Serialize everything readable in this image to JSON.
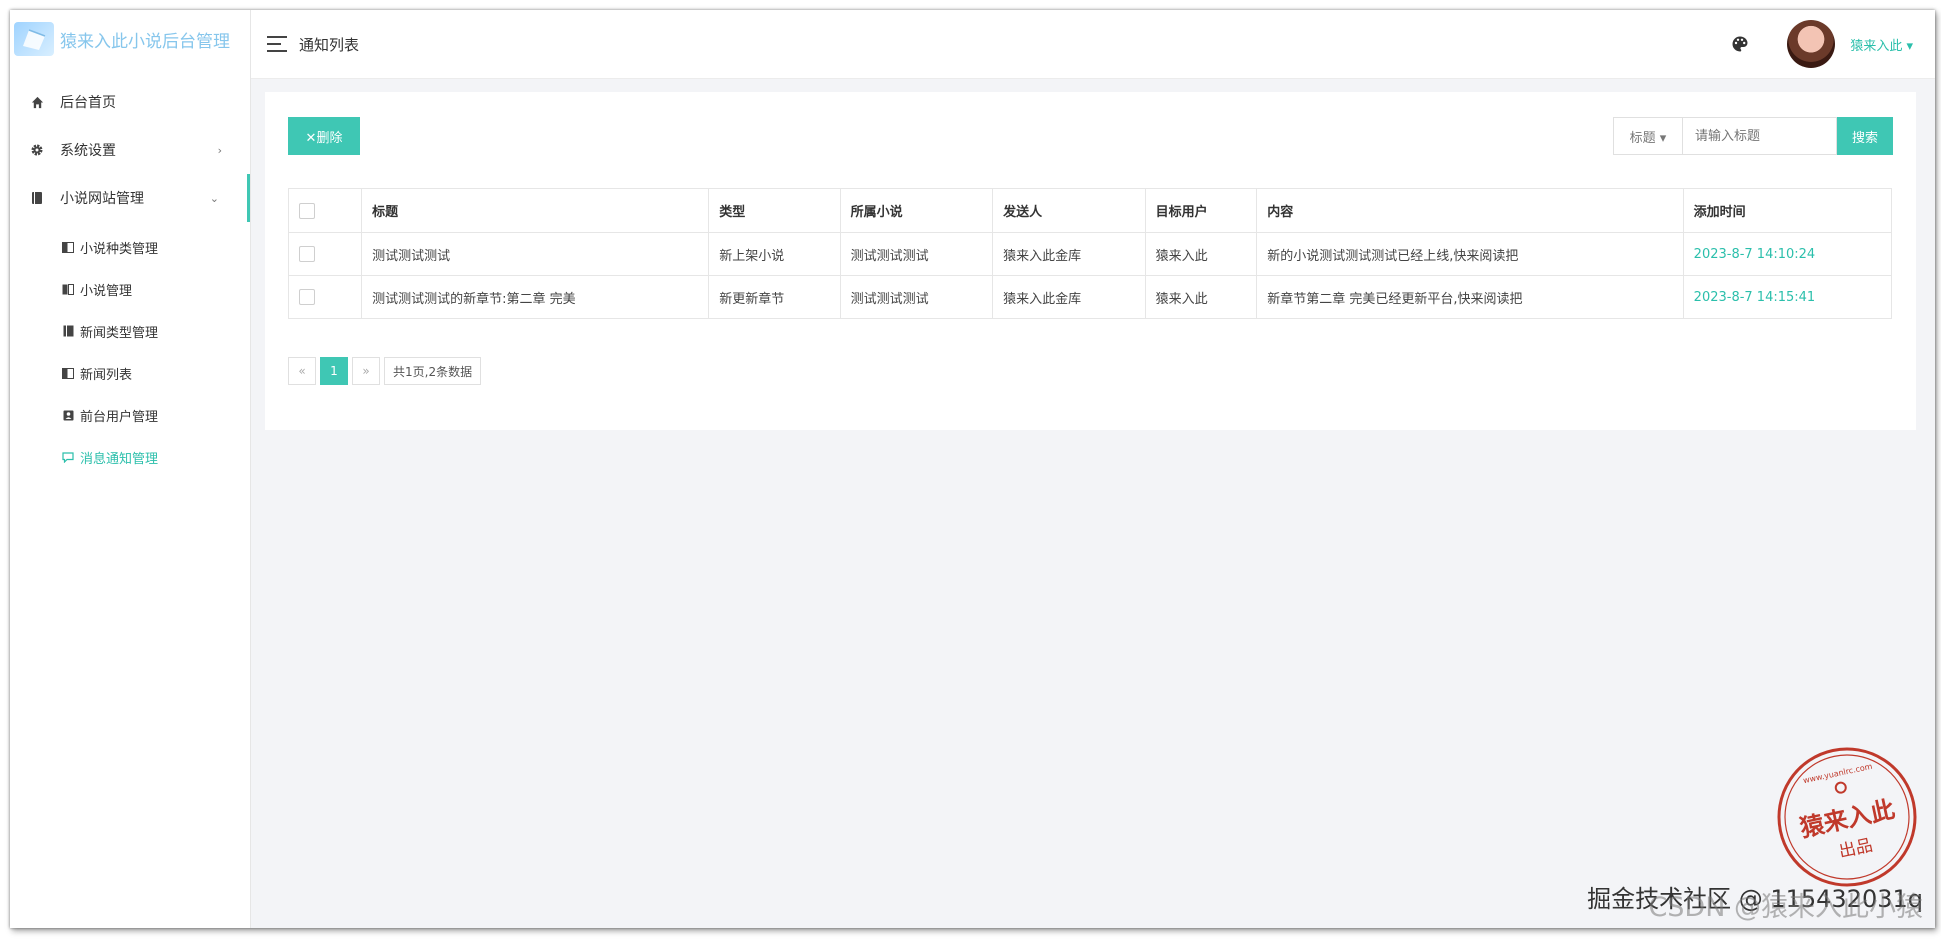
{
  "app": {
    "title": "猿来入此小说后台管理"
  },
  "sidebar": {
    "items": [
      {
        "label": "后台首页",
        "icon": "home-icon"
      },
      {
        "label": "系统设置",
        "icon": "gear-icon",
        "arrow": "›"
      },
      {
        "label": "小说网站管理",
        "icon": "book-icon",
        "arrow": "⌄"
      }
    ],
    "subitems": [
      {
        "label": "小说种类管理",
        "icon": "category-icon"
      },
      {
        "label": "小说管理",
        "icon": "novel-icon"
      },
      {
        "label": "新闻类型管理",
        "icon": "news-type-icon"
      },
      {
        "label": "新闻列表",
        "icon": "news-list-icon"
      },
      {
        "label": "前台用户管理",
        "icon": "user-card-icon"
      },
      {
        "label": "消息通知管理",
        "icon": "message-icon",
        "active": true
      }
    ]
  },
  "header": {
    "page_title": "通知列表",
    "user_name": "猿来入此 ▾"
  },
  "toolbar": {
    "delete_label": "✕删除",
    "search_field": "标题 ▾",
    "search_placeholder": "请输入标题",
    "search_label": "搜索"
  },
  "table": {
    "headers": [
      "标题",
      "类型",
      "所属小说",
      "发送人",
      "目标用户",
      "内容",
      "添加时间"
    ],
    "rows": [
      [
        "测试测试测试",
        "新上架小说",
        "测试测试测试",
        "猿来入此金库",
        "猿来入此",
        "新的小说测试测试测试已经上线,快来阅读把",
        "2023-8-7 14:10:24"
      ],
      [
        "测试测试测试的新章节:第二章 完美",
        "新更新章节",
        "测试测试测试",
        "猿来入此金库",
        "猿来入此",
        "新章节第二章 完美已经更新平台,快来阅读把",
        "2023-8-7 14:15:41"
      ]
    ]
  },
  "pager": {
    "prev": "«",
    "current": "1",
    "next": "»",
    "info": "共1页,2条数据"
  },
  "stamp": {
    "text": "猿来入此",
    "sub": "出品",
    "url": "www.yuanlrc.com"
  },
  "watermark": {
    "line1": "掘金技术社区 @ 115432031q",
    "line2": "CSDN @猿来入此小猿"
  },
  "colors": {
    "accent": "#3fc7b4",
    "stamp": "#c0392b"
  }
}
